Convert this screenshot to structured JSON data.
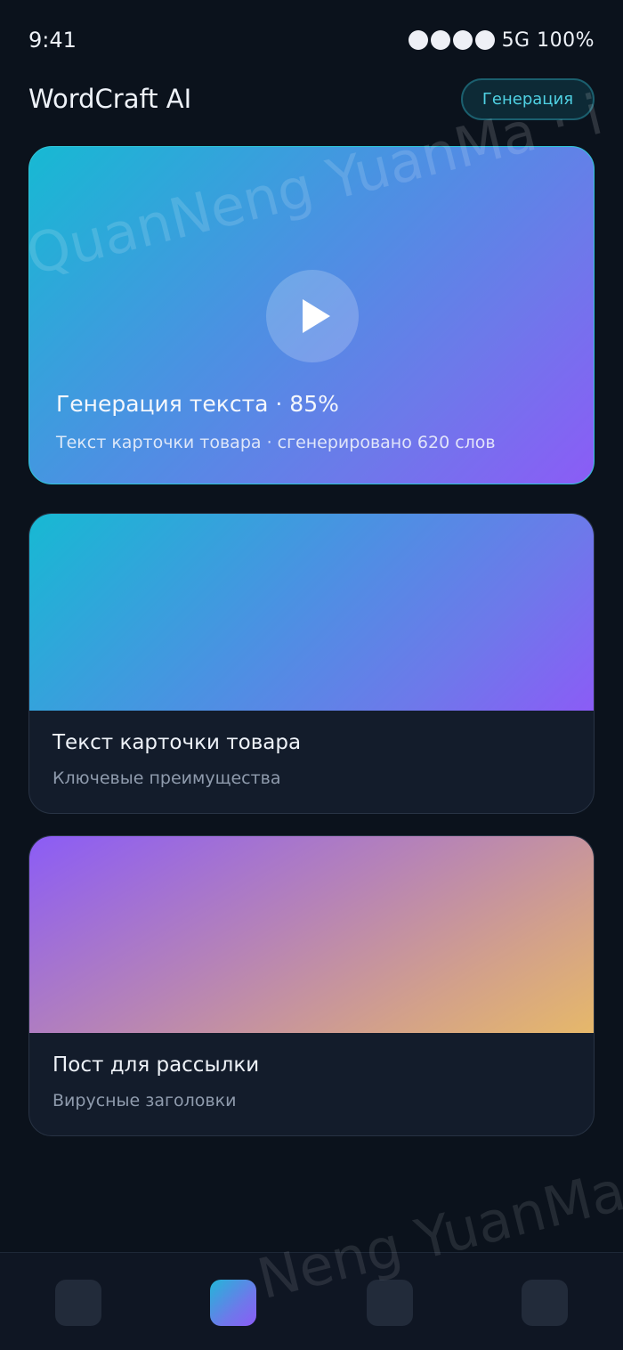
{
  "status_bar": {
    "time": "9:41",
    "network": "5G 100%"
  },
  "header": {
    "title": "WordCraft AI",
    "pill_label": "Генерация"
  },
  "hero": {
    "title": "Генерация текста · 85%",
    "subtitle": "Текст карточки товара · сгенерировано 620 слов",
    "progress_percent": 85
  },
  "cards": [
    {
      "title": "Текст карточки товара",
      "subtitle": "Ключевые преимущества"
    },
    {
      "title": "Пост для рассылки",
      "subtitle": "Вирусные заголовки"
    }
  ],
  "watermark": {
    "text_1": "QuanNeng YuanMa · i",
    "text_2": "Neng YuanMa"
  },
  "colors": {
    "background": "#0b121c",
    "accent_cyan": "#17b9d3",
    "accent_violet": "#8b5cf6",
    "accent_amber": "#e6b86a",
    "pill_text": "#4fd1e3"
  },
  "icons": {
    "hero_play": "play-icon",
    "nav": [
      "nav-tab-1",
      "nav-tab-2-active",
      "nav-tab-3",
      "nav-tab-4"
    ]
  }
}
